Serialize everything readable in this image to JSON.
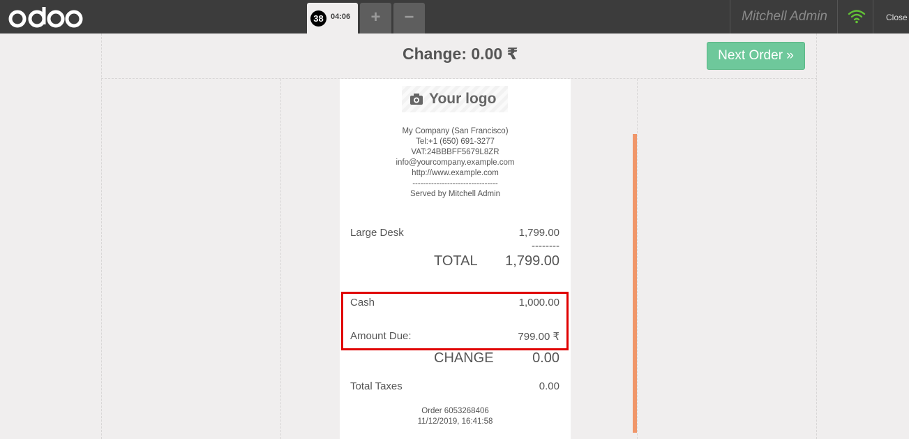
{
  "app": {
    "brand": "odoo",
    "accent_color": "#6ec89b",
    "highlight_color": "#e00000"
  },
  "order_tab": {
    "sequence": "38",
    "time": "04:06"
  },
  "tabs": {
    "add_label": "+",
    "remove_label": "−"
  },
  "user": {
    "name": "Mitchell Admin",
    "connection_icon": "wifi-icon"
  },
  "header": {
    "close_label": "Close"
  },
  "screen": {
    "change_title": "Change: 0.00 ₹",
    "next_order_label": "Next Order »"
  },
  "receipt": {
    "logo_text": "Your logo",
    "company": "My Company (San Francisco)",
    "tel": "Tel:+1 (650) 691-3277",
    "vat": "VAT:24BBBFF5679L8ZR",
    "email": "info@yourcompany.example.com",
    "website": "http://www.example.com",
    "separator": "--------------------------------",
    "served_by": "Served by Mitchell Admin",
    "lines": [
      {
        "product": "Large Desk",
        "price": "1,799.00"
      }
    ],
    "subtotal_separator": "--------",
    "total_label": "TOTAL",
    "total_value": "1,799.00",
    "payments": [
      {
        "method": "Cash",
        "amount": "1,000.00"
      }
    ],
    "amount_due_label": "Amount Due:",
    "amount_due_value": "799.00 ₹",
    "change_label": "CHANGE",
    "change_value": "0.00",
    "taxes_label": "Total Taxes",
    "taxes_value": "0.00",
    "order_ref": "Order 6053268406",
    "order_date": "11/12/2019, 16:41:58"
  }
}
